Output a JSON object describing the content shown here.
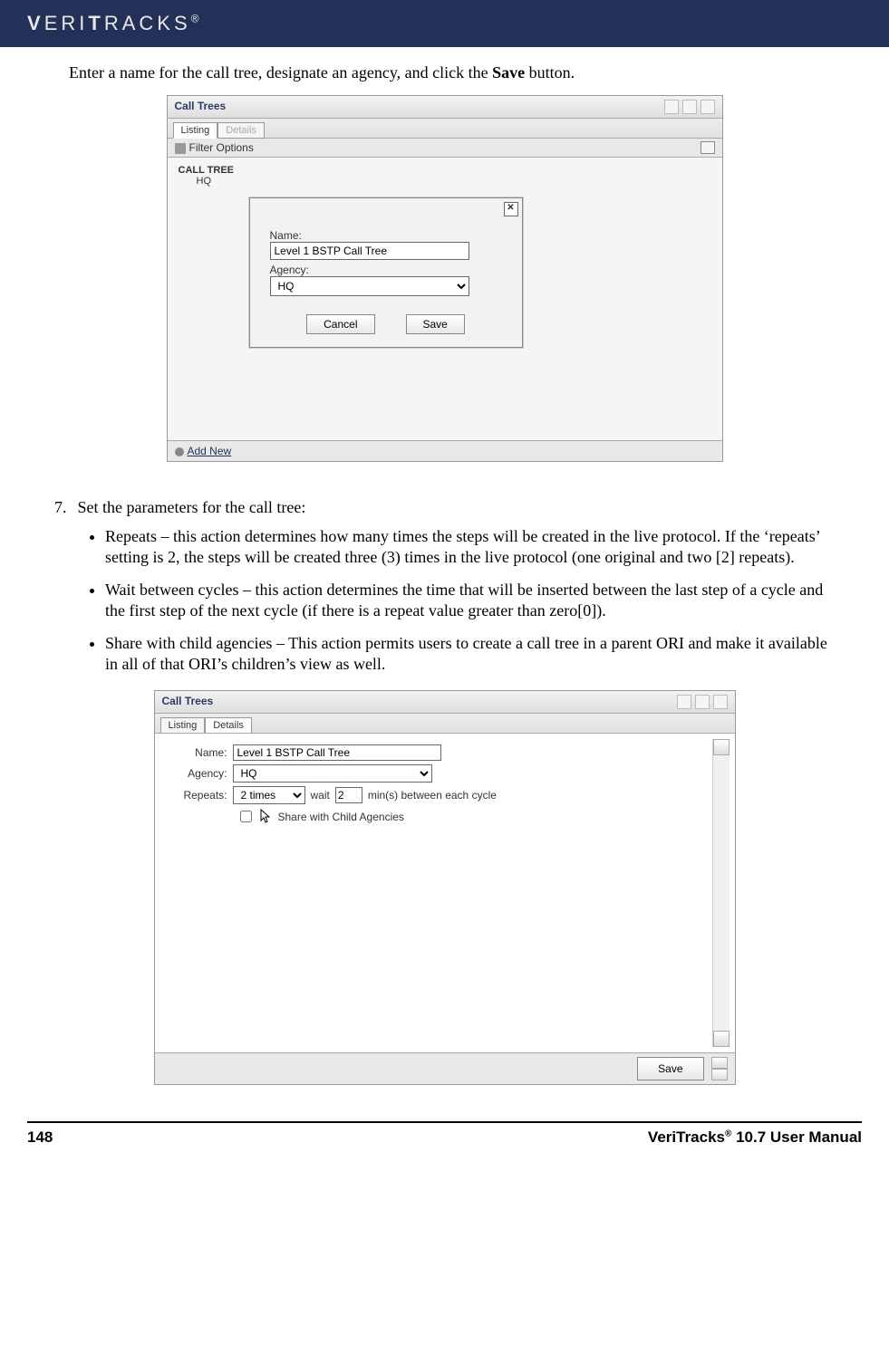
{
  "brand": "VERITRACKS",
  "intro_line_prefix": "Enter a name for the call tree, designate an agency, and click the ",
  "intro_line_bold": "Save",
  "intro_line_suffix": " button.",
  "screenshot1": {
    "title": "Call Trees",
    "tabs": {
      "listing": "Listing",
      "details": "Details"
    },
    "filter_label": "Filter Options",
    "tree_heading": "CALL TREE",
    "tree_item": "HQ",
    "dialog": {
      "name_label": "Name:",
      "name_value": "Level 1 BSTP Call Tree",
      "agency_label": "Agency:",
      "agency_value": "HQ",
      "cancel": "Cancel",
      "save": "Save"
    },
    "add_new": "Add New"
  },
  "step_number": "7.",
  "step_text": "Set the parameters for the call tree:",
  "bullets": [
    "Repeats – this action determines how many times the steps will be created in the live protocol.  If the ‘repeats’ setting is 2, the steps will be created three (3) times in the live protocol (one original and two [2] repeats).",
    "Wait between cycles – this action determines the time that will be inserted between the last step of a cycle and the first step of the next cycle (if there is a repeat value greater than zero[0]).",
    "Share with child agencies – This action permits users to create a call tree in a parent ORI and make it available in all of that ORI’s children’s view as well."
  ],
  "screenshot2": {
    "title": "Call Trees",
    "tabs": {
      "listing": "Listing",
      "details": "Details"
    },
    "name_label": "Name:",
    "name_value": "Level 1 BSTP Call Tree",
    "agency_label": "Agency:",
    "agency_value": "HQ",
    "repeats_label": "Repeats:",
    "repeats_value": "2 times",
    "wait_label": "wait",
    "wait_value": "2",
    "wait_suffix": "min(s) between each cycle",
    "share_label": "Share with Child Agencies",
    "save": "Save"
  },
  "footer": {
    "page_num": "148",
    "product": "VeriTracks",
    "version_suffix": " 10.7 User Manual"
  }
}
